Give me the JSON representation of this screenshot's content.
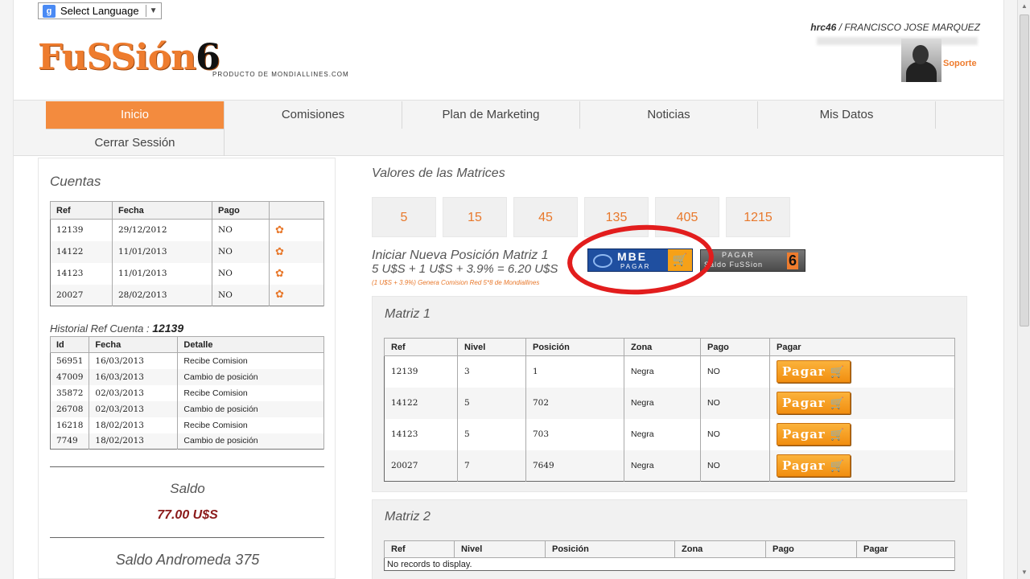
{
  "language": {
    "label": "Select Language"
  },
  "brand": {
    "logo_main": "FuSSión",
    "logo_six": "6",
    "tagline": "PRODUCTO DE MONDIALLINES.COM"
  },
  "user": {
    "username": "hrc46",
    "separator": " / ",
    "fullname": "FRANCISCO JOSE MARQUEZ",
    "support": "Soporte"
  },
  "nav": {
    "items": [
      "Inicio",
      "Comisiones",
      "Plan de Marketing",
      "Noticias",
      "Mis Datos"
    ],
    "logout": "Cerrar Sessión"
  },
  "cuentas": {
    "title": "Cuentas",
    "headers": [
      "Ref",
      "Fecha",
      "Pago",
      ""
    ],
    "rows": [
      [
        "12139",
        "29/12/2012",
        "NO"
      ],
      [
        "14122",
        "11/01/2013",
        "NO"
      ],
      [
        "14123",
        "11/01/2013",
        "NO"
      ],
      [
        "20027",
        "28/02/2013",
        "NO"
      ]
    ]
  },
  "historial": {
    "title": "Historial Ref Cuenta :",
    "ref": "12139",
    "headers": [
      "Id",
      "Fecha",
      "Detalle"
    ],
    "rows": [
      [
        "56951",
        "16/03/2013",
        "Recibe Comision"
      ],
      [
        "47009",
        "16/03/2013",
        "Cambio de posición"
      ],
      [
        "35872",
        "02/03/2013",
        "Recibe Comision"
      ],
      [
        "26708",
        "02/03/2013",
        "Cambio de posición"
      ],
      [
        "16218",
        "18/02/2013",
        "Recibe Comision"
      ],
      [
        "7749",
        "18/02/2013",
        "Cambio de posición"
      ]
    ]
  },
  "saldo": {
    "label": "Saldo",
    "value": "77.00 U$S",
    "andromeda": "Saldo Andromeda 375"
  },
  "matrices": {
    "title": "Valores de las Matrices",
    "values": [
      "5",
      "15",
      "45",
      "135",
      "405",
      "1215"
    ]
  },
  "nueva": {
    "line1": "Iniciar Nueva Posición Matriz 1",
    "line2": "5 U$S + 1 U$S + 3.9% = 6.20 U$S",
    "note": "(1 U$S + 3.9%) Genera Comision Red 5*8 de Mondiallines"
  },
  "mbe": {
    "label": "MBE",
    "sub": "PAGAR"
  },
  "pagar_fussion": {
    "line1": "PAGAR",
    "line2": "Saldo FuSSion",
    "six": "6"
  },
  "matriz1": {
    "title": "Matriz 1",
    "headers": [
      "Ref",
      "Nivel",
      "Posición",
      "Zona",
      "Pago",
      "Pagar"
    ],
    "rows": [
      [
        "12139",
        "3",
        "1",
        "Negra",
        "NO"
      ],
      [
        "14122",
        "5",
        "702",
        "Negra",
        "NO"
      ],
      [
        "14123",
        "5",
        "703",
        "Negra",
        "NO"
      ],
      [
        "20027",
        "7",
        "7649",
        "Negra",
        "NO"
      ]
    ],
    "pay_label": "Pagar"
  },
  "matriz2": {
    "title": "Matriz 2",
    "headers": [
      "Ref",
      "Nivel",
      "Posición",
      "Zona",
      "Pago",
      "Pagar"
    ],
    "empty": "No records to display."
  },
  "colors": {
    "accent": "#ee7c2e",
    "nav_active": "#f38b3e",
    "saldo": "#8b1a1a",
    "highlight": "#e21d1d"
  }
}
